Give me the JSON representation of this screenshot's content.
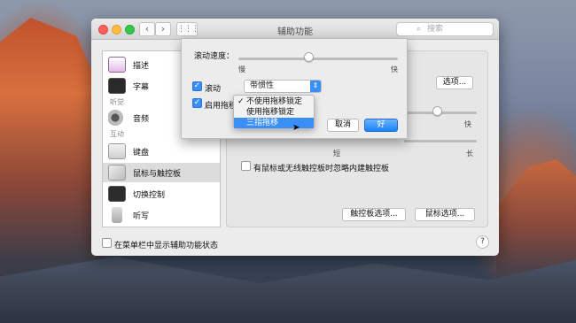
{
  "window": {
    "title": "辅助功能",
    "search_placeholder": "搜索",
    "nav_back": "‹",
    "nav_forward": "›",
    "grid": "⋮⋮⋮"
  },
  "sidebar": {
    "items": [
      {
        "label": "描述",
        "icon": "description-icon"
      },
      {
        "label": "字幕",
        "icon": "captions-icon"
      },
      {
        "section": "听觉"
      },
      {
        "label": "音频",
        "icon": "speaker-icon"
      },
      {
        "section": "互动"
      },
      {
        "label": "键盘",
        "icon": "keyboard-icon"
      },
      {
        "label": "鼠标与触控板",
        "icon": "mouse-icon",
        "selected": true
      },
      {
        "label": "切换控制",
        "icon": "switch-icon"
      },
      {
        "label": "听写",
        "icon": "microphone-icon"
      }
    ]
  },
  "pane": {
    "options_button": "选项...",
    "speed_fast": "快",
    "spring_short": "短",
    "spring_long": "长",
    "ignore_trackpad_label": "有鼠标或无线触控板时忽略内建触控板",
    "trackpad_options": "触控板选项...",
    "mouse_options": "鼠标选项..."
  },
  "bottom": {
    "show_status_label": "在菜单栏中显示辅助功能状态",
    "help": "?"
  },
  "sheet": {
    "scroll_speed_label": "滚动速度：",
    "slow": "慢",
    "fast": "快",
    "scroll_label": "滚动",
    "scroll_checked": true,
    "scroll_mode": "带惯性",
    "drag_label": "启用拖移",
    "drag_checked": true,
    "drag_menu": [
      {
        "label": "不使用拖移锁定",
        "checked": true
      },
      {
        "label": "使用拖移锁定",
        "checked": false
      },
      {
        "label": "三指拖移",
        "highlighted": true
      }
    ],
    "cancel": "取消",
    "ok": "好"
  },
  "colors": {
    "accent": "#3a8ff7",
    "primary_button": "#1a82fb"
  }
}
